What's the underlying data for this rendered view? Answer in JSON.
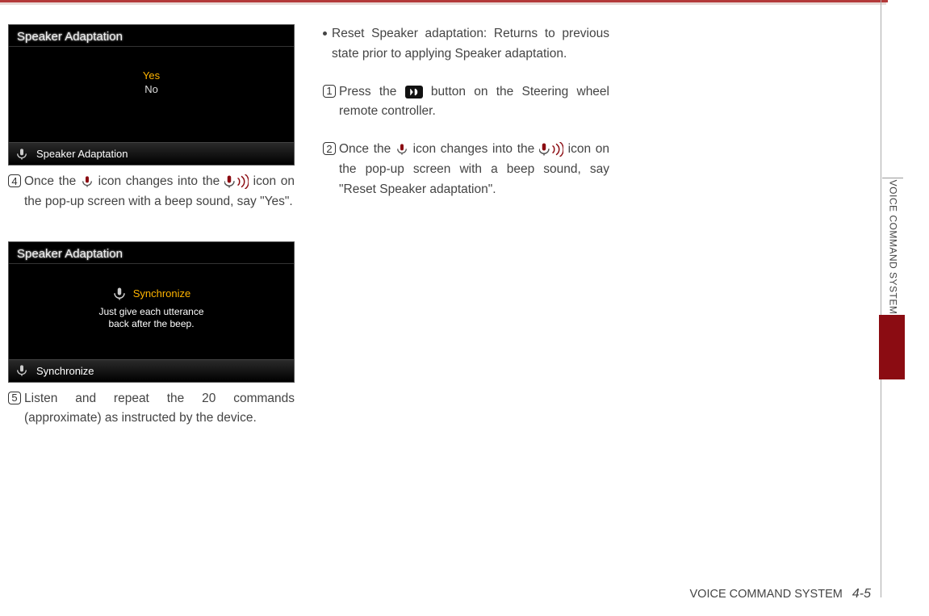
{
  "sideTab": {
    "label": "VOICE COMMAND SYSTEM"
  },
  "footer": {
    "section": "VOICE COMMAND SYSTEM",
    "page": "4-5"
  },
  "screenshot1": {
    "title": "Speaker Adaptation",
    "optYes": "Yes",
    "optNo": "No",
    "footerLabel": "Speaker Adaptation"
  },
  "screenshot2": {
    "title": "Speaker Adaptation",
    "syncLabel": "Synchronize",
    "line1": "Just give each utterance",
    "line2": "back after the beep.",
    "footerLabel": "Synchronize"
  },
  "col1": {
    "step4_a": "Once the ",
    "step4_b": " icon changes into the ",
    "step4_c": " icon on the pop-up screen with a beep sound, say \"Yes\".",
    "step5": "Listen and repeat the 20 commands (approximate) as instructed by the device."
  },
  "col2": {
    "bullet": "Reset Speaker adaptation: Returns to previous state prior to applying Speaker adaptation.",
    "step1_a": "Press the ",
    "step1_b": " button on the Steering wheel remote controller.",
    "step2_a": "Once the ",
    "step2_b": " icon changes into the ",
    "step2_c": " icon on the pop-up screen with a beep sound, say \"Reset Speaker adaptation\"."
  },
  "stepNums": {
    "s1": "1",
    "s2": "2",
    "s4": "4",
    "s5": "5"
  }
}
